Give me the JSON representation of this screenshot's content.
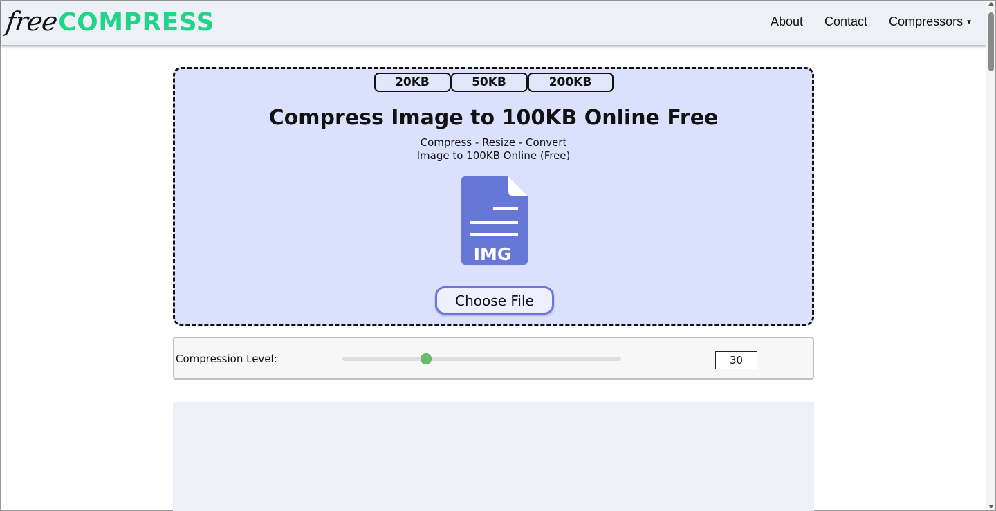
{
  "header": {
    "logo_free": "free",
    "logo_compress": "COMPRESS",
    "nav": {
      "about": "About",
      "contact": "Contact",
      "compressors": "Compressors"
    }
  },
  "upload": {
    "size_tabs": [
      "20KB",
      "50KB",
      "200KB"
    ],
    "title": "Compress Image to 100KB Online Free",
    "subtitle_line1": "Compress - Resize - Convert",
    "subtitle_line2": "Image to 100KB Online (Free)",
    "file_icon_label": "IMG",
    "choose_file": "Choose File"
  },
  "compression": {
    "label": "Compression Level:",
    "value": "30",
    "slider_fraction": 0.3
  },
  "colors": {
    "logo_accent": "#22d48a",
    "panel_bg": "#dbe1fc",
    "icon_blue": "#6677d8",
    "button_border": "#6a76dd",
    "slider_thumb": "#6cbe6c"
  },
  "icons": [
    "file-image-icon",
    "caret-down-icon"
  ]
}
